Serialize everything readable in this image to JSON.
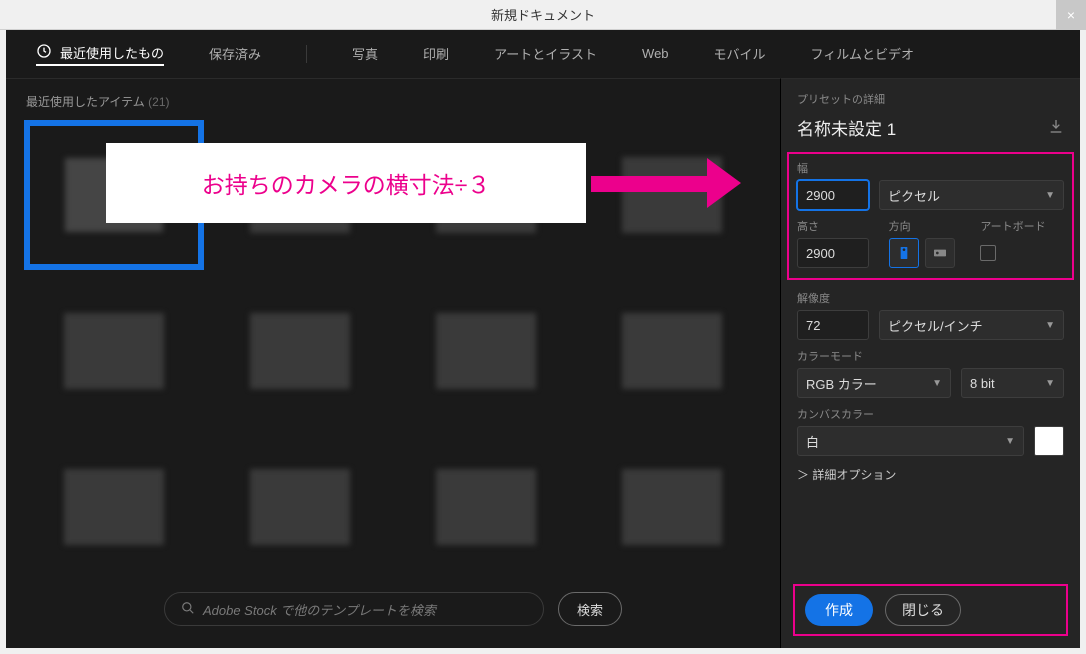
{
  "window": {
    "title": "新規ドキュメント",
    "close": "×"
  },
  "tabs": {
    "recent": "最近使用したもの",
    "saved": "保存済み",
    "photo": "写真",
    "print": "印刷",
    "art": "アートとイラスト",
    "web": "Web",
    "mobile": "モバイル",
    "film": "フィルムとビデオ"
  },
  "left": {
    "header_label": "最近使用したアイテム",
    "header_count": "(21)",
    "search_placeholder": "Adobe Stock で他のテンプレートを検索",
    "search_btn": "検索"
  },
  "annotation": {
    "text": "お持ちのカメラの横寸法÷３"
  },
  "right": {
    "preset_label": "プリセットの詳細",
    "doc_name": "名称未設定 1",
    "width_label": "幅",
    "width_value": "2900",
    "unit": "ピクセル",
    "height_label": "高さ",
    "height_value": "2900",
    "orient_label": "方向",
    "artboard_label": "アートボード",
    "res_label": "解像度",
    "res_value": "72",
    "res_unit": "ピクセル/インチ",
    "color_label": "カラーモード",
    "color_mode": "RGB カラー",
    "bit_depth": "8 bit",
    "canvas_label": "カンバスカラー",
    "canvas_value": "白",
    "advanced": "詳細オプション",
    "create": "作成",
    "close": "閉じる"
  }
}
